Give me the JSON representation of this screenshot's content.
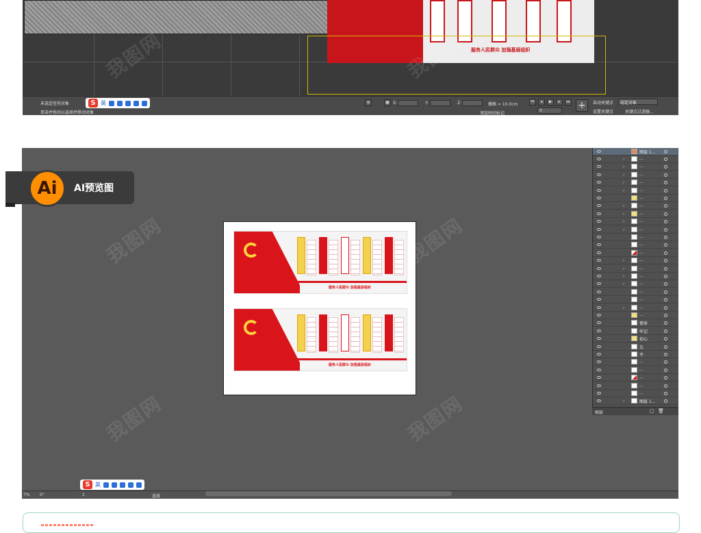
{
  "max": {
    "status_line1": "未选定任何对象",
    "status_line2": "单击并拖动以选择并移动对象",
    "x_label": "X:",
    "y_label": "Y:",
    "z_label": "Z:",
    "grid_label": "栅格 = 10.0cm",
    "add_time_tag": "添加时间标记",
    "auto_key": "自动关键点",
    "selected_object": "选定对象",
    "set_key": "设置关键点",
    "key_filter": "关键点过滤器...",
    "frame_value": "0",
    "scene_slogan": "服务人民群众 加强基层组织"
  },
  "ime": {
    "logo": "S",
    "mode": "英"
  },
  "ai": {
    "badge_letter": "Ai",
    "badge_label": "AI预览图",
    "wall_slogan": "服务人民群众 加强基层组织",
    "status_zoom": "7%",
    "status_angle": "0°",
    "status_page": "1",
    "status_tool": "选择"
  },
  "layers": {
    "top_layer_name": "图层 1...",
    "footer_label": "图层",
    "rows": [
      {
        "name": "...",
        "thumb": "w",
        "arrow": true
      },
      {
        "name": "...",
        "thumb": "w",
        "arrow": true
      },
      {
        "name": "...",
        "thumb": "w",
        "arrow": true
      },
      {
        "name": "...",
        "thumb": "w",
        "arrow": true
      },
      {
        "name": "...",
        "thumb": "w",
        "arrow": true
      },
      {
        "name": "...",
        "thumb": "y",
        "arrow": false
      },
      {
        "name": "...",
        "thumb": "w",
        "arrow": true
      },
      {
        "name": "...",
        "thumb": "y",
        "arrow": true
      },
      {
        "name": "...",
        "thumb": "w",
        "arrow": true
      },
      {
        "name": "...",
        "thumb": "w",
        "arrow": true
      },
      {
        "name": "...",
        "thumb": "w",
        "arrow": false
      },
      {
        "name": "...",
        "thumb": "w",
        "arrow": false
      },
      {
        "name": "...",
        "thumb": "r",
        "arrow": false
      },
      {
        "name": "...",
        "thumb": "w",
        "arrow": true
      },
      {
        "name": "...",
        "thumb": "w",
        "arrow": true
      },
      {
        "name": "...",
        "thumb": "w",
        "arrow": true
      },
      {
        "name": "...",
        "thumb": "w",
        "arrow": true
      },
      {
        "name": "...",
        "thumb": "w",
        "arrow": false
      },
      {
        "name": "...",
        "thumb": "w",
        "arrow": false
      },
      {
        "name": "...",
        "thumb": "w",
        "arrow": true
      },
      {
        "name": "...",
        "thumb": "y",
        "arrow": false
      },
      {
        "name": "使命",
        "thumb": "w",
        "arrow": false
      },
      {
        "name": "牢记",
        "thumb": "w",
        "arrow": false
      },
      {
        "name": "初心",
        "thumb": "y",
        "arrow": false
      },
      {
        "name": "忘",
        "thumb": "w",
        "arrow": false
      },
      {
        "name": "不",
        "thumb": "w",
        "arrow": false
      },
      {
        "name": "...",
        "thumb": "w",
        "arrow": false
      },
      {
        "name": "...",
        "thumb": "w",
        "arrow": false
      },
      {
        "name": "...",
        "thumb": "r",
        "arrow": false
      },
      {
        "name": "...",
        "thumb": "w",
        "arrow": false
      },
      {
        "name": "...",
        "thumb": "w",
        "arrow": false
      },
      {
        "name": "图层 1...",
        "thumb": "w",
        "arrow": true
      }
    ]
  },
  "colors": {
    "accent_red": "#d9141b",
    "ai_orange": "#ff8f00",
    "render_frame": "#d7b400"
  },
  "watermark": "我图网"
}
